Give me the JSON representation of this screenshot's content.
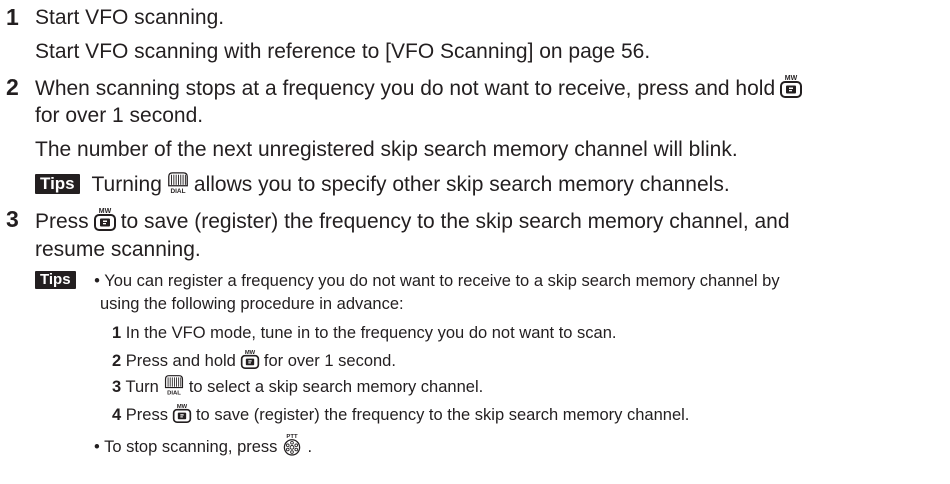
{
  "steps": [
    {
      "num": "1",
      "lines": [
        "Start VFO scanning.",
        "Start VFO scanning with reference to [VFO Scanning] on page 56."
      ]
    },
    {
      "num": "2",
      "line1a": "When scanning stops at a frequency you do not want to receive, press and hold",
      "line2": "for over 1 second.",
      "line3": "The number of the next unregistered skip search memory channel will blink.",
      "tip": {
        "badge": "Tips",
        "a": "Turning",
        "b": "allows you to specify other skip search memory channels."
      }
    },
    {
      "num": "3",
      "line1a": "Press",
      "line1b": "to save (register) the frequency to the skip search memory channel, and",
      "line2": "resume scanning."
    }
  ],
  "tips": {
    "badge": "Tips",
    "bullet": "•",
    "b1_line1": "You can register a frequency you do not want to receive to a skip search memory channel by",
    "b1_line2": "using the following procedure in advance:",
    "sub": [
      {
        "n": "1",
        "a": "In the VFO mode, tune in to the frequency you do not want to scan.",
        "b": ""
      },
      {
        "n": "2",
        "a": "Press and hold",
        "b": "for over 1 second."
      },
      {
        "n": "3",
        "a": "Turn",
        "b": "to select a skip search memory channel."
      },
      {
        "n": "4",
        "a": "Press",
        "b": "to save (register) the frequency to the skip search memory channel."
      }
    ],
    "b2": "To stop scanning, press"
  },
  "icons": {
    "mw_key": "MW",
    "dial": "DIAL",
    "ptt": "PTT",
    "key_letter": "F"
  }
}
